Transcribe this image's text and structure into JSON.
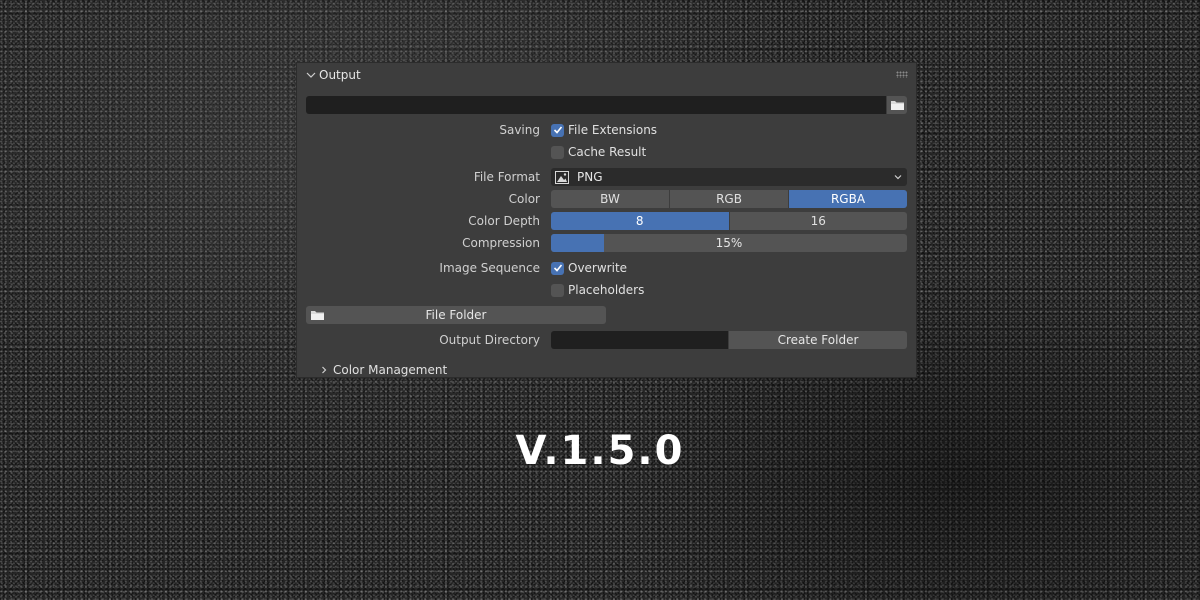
{
  "panel": {
    "title": "Output",
    "output_path": "",
    "icons": {
      "header": "chevron-down-icon",
      "grip": "drag-grip-icon",
      "path_browse": "folder-icon"
    }
  },
  "saving": {
    "label": "Saving",
    "file_extensions": {
      "label": "File Extensions",
      "checked": true
    },
    "cache_result": {
      "label": "Cache Result",
      "checked": false
    }
  },
  "file_format": {
    "label": "File Format",
    "value": "PNG",
    "icon": "image-icon"
  },
  "color": {
    "label": "Color",
    "options": [
      "BW",
      "RGB",
      "RGBA"
    ],
    "selected": "RGBA"
  },
  "color_depth": {
    "label": "Color Depth",
    "options": [
      "8",
      "16"
    ],
    "selected": "8"
  },
  "compression": {
    "label": "Compression",
    "value_text": "15%",
    "value": 0.15
  },
  "image_sequence": {
    "label": "Image Sequence",
    "overwrite": {
      "label": "Overwrite",
      "checked": true
    },
    "placeholders": {
      "label": "Placeholders",
      "checked": false
    }
  },
  "file_folder": {
    "label": "File Folder",
    "icon": "folder-icon"
  },
  "output_directory": {
    "label": "Output Directory",
    "value": "",
    "button": "Create Folder"
  },
  "color_management": {
    "label": "Color Management",
    "icon": "chevron-right-icon"
  },
  "accent_color": "#4772b3",
  "version": "V.1.5.0"
}
